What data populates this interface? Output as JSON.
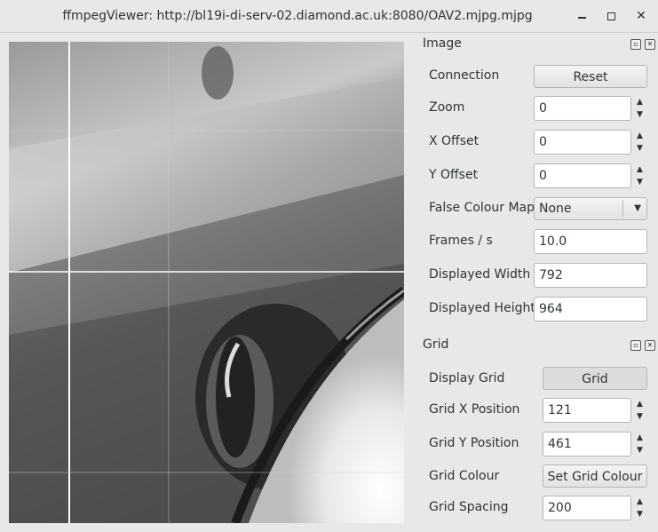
{
  "window": {
    "title": "ffmpegViewer: http://bl19i-di-serv-02.diamond.ac.uk:8080/OAV2.mjpg.mjpg",
    "minimize_icon": "minimize-icon",
    "maximize_icon": "maximize-icon",
    "close_icon": "close-icon",
    "close_label": "✕"
  },
  "image_panel": {
    "title": "Image",
    "float_label": "▫",
    "close_label": "✕",
    "connection_label": "Connection",
    "reset_label": "Reset",
    "zoom_label": "Zoom",
    "zoom_value": "0",
    "x_offset_label": "X Offset",
    "x_offset_value": "0",
    "y_offset_label": "Y Offset",
    "y_offset_value": "0",
    "false_colour_label": "False Colour Map",
    "false_colour_value": "None",
    "fps_label": "Frames / s",
    "fps_value": "10.0",
    "width_label": "Displayed Width",
    "width_value": "792",
    "height_label": "Displayed Height",
    "height_value": "964"
  },
  "grid_panel": {
    "title": "Grid",
    "float_label": "▫",
    "close_label": "✕",
    "display_grid_label": "Display Grid",
    "grid_button_label": "Grid",
    "grid_x_label": "Grid X Position",
    "grid_x_value": "121",
    "grid_y_label": "Grid Y Position",
    "grid_y_value": "461",
    "grid_colour_label": "Grid Colour",
    "set_colour_label": "Set Grid Colour",
    "grid_spacing_label": "Grid Spacing",
    "grid_spacing_value": "200"
  },
  "spin": {
    "up": "▲",
    "down": "▼"
  },
  "combo_arrow": "▼"
}
